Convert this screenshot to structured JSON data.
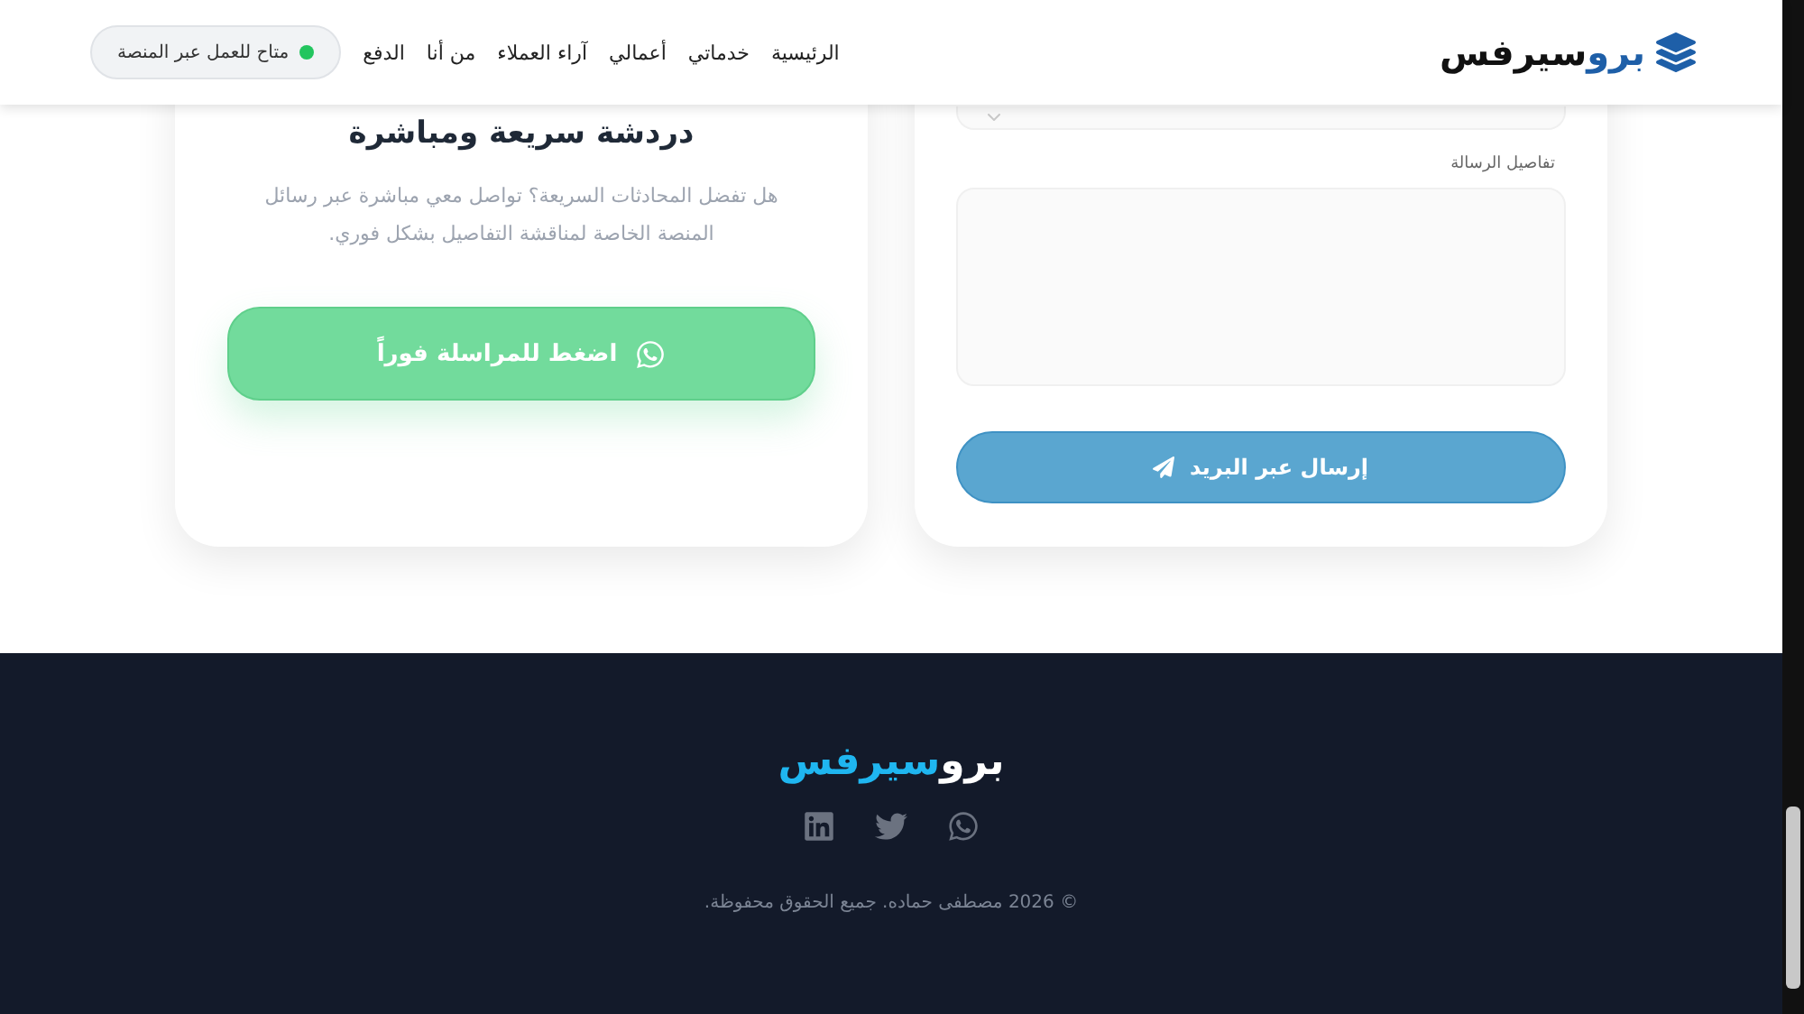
{
  "header": {
    "logo": {
      "part_1": "برو",
      "part_2": "سيرفس"
    },
    "nav": [
      {
        "label": "الرئيسية"
      },
      {
        "label": "خدماتي"
      },
      {
        "label": "أعمالي"
      },
      {
        "label": "آراء العملاء"
      },
      {
        "label": "من أنا"
      },
      {
        "label": "الدفع"
      }
    ],
    "status_badge": {
      "label": "متاح للعمل عبر المنصة",
      "available": true
    }
  },
  "contact_form": {
    "message_label": "تفاصيل الرسالة",
    "submit_button": "إرسال عبر البريد"
  },
  "chat_card": {
    "title": "دردشة سريعة ومباشرة",
    "description": "هل تفضل المحادثات السريعة؟ تواصل معي مباشرة عبر رسائل المنصة الخاصة لمناقشة التفاصيل بشكل فوري.",
    "button": "اضغط للمراسلة فوراً"
  },
  "footer": {
    "logo": {
      "part_1": "برو",
      "part_2": "سيرفس"
    },
    "social": [
      {
        "kind": "linkedin"
      },
      {
        "kind": "twitter"
      },
      {
        "kind": "whatsapp"
      }
    ],
    "copyright": "© 2026 مصطفى حماده. جميع الحقوق محفوظة."
  }
}
